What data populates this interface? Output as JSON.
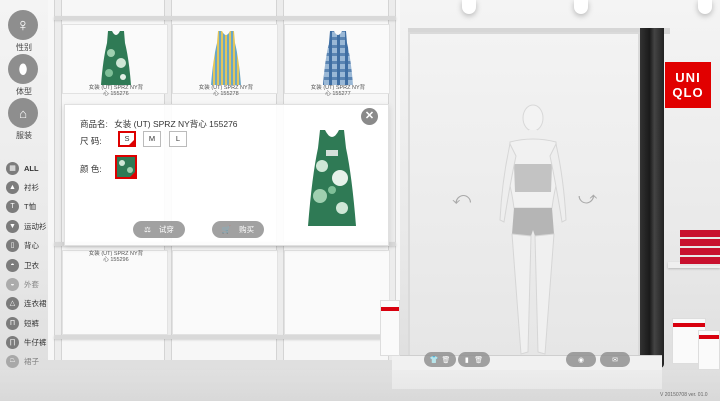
{
  "toolbar": {
    "gender_label": "性别",
    "body_label": "体型",
    "clothing_label": "服装",
    "categories": [
      {
        "label": "ALL",
        "bold": true
      },
      {
        "label": "衬衫"
      },
      {
        "label": "T恤"
      },
      {
        "label": "运动衫"
      },
      {
        "label": "背心"
      },
      {
        "label": "卫衣"
      },
      {
        "label": "外套"
      },
      {
        "label": "连衣裙"
      },
      {
        "label": "短裤"
      },
      {
        "label": "牛仔裤"
      },
      {
        "label": "裙子"
      }
    ]
  },
  "shelf": {
    "items": [
      {
        "label_line1": "女装 (UT) SPRZ NY背",
        "label_line2": "心 155276",
        "pattern": "floral-green"
      },
      {
        "label_line1": "女装 (UT) SPRZ NY背",
        "label_line2": "心 155278",
        "pattern": "stripe-yellow"
      },
      {
        "label_line1": "女装 (UT) SPRZ NY背",
        "label_line2": "心 155277",
        "pattern": "plaid-blue"
      },
      {
        "label_line1": "女装 (UT) SPRZ NY背",
        "label_line2": "心 155296",
        "pattern": "floral-green"
      }
    ]
  },
  "product": {
    "name_label": "商品名:",
    "name_value": "女装 (UT) SPRZ NY背心 155276",
    "size_label": "尺    码:",
    "sizes": [
      "S",
      "M",
      "L"
    ],
    "selected_size": "S",
    "color_label": "颜    色:",
    "try_on_label": "试穿",
    "buy_label": "购买"
  },
  "store": {
    "brand": "UNI QLO",
    "brand_line1": "UNI",
    "brand_line2": "QLO"
  },
  "bottom_bar": {
    "left_icons": [
      "shirt-icon",
      "trash-icon",
      "shirt-icon",
      "trash-icon"
    ],
    "right_icons": [
      "weibo-icon",
      "wechat-icon"
    ]
  },
  "version": "V 20150708  ver. 01.0",
  "colors": {
    "accent_red": "#d00000",
    "brand_red": "#e10000",
    "toolbar_gray": "#8e8e8e"
  }
}
